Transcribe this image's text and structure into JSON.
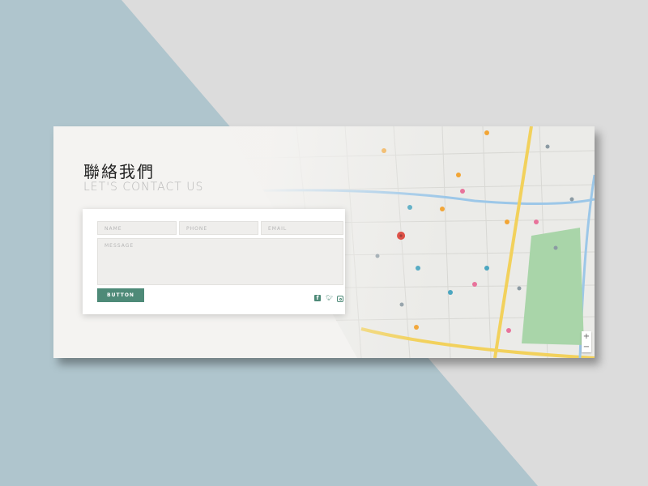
{
  "heading": {
    "title_cn": "聯絡我們",
    "title_en": "LET'S CONTACT US"
  },
  "form": {
    "name_placeholder": "NAME",
    "phone_placeholder": "PHONE",
    "email_placeholder": "EMAIL",
    "message_placeholder": "MESSAGE",
    "button_label": "BUTTON"
  },
  "social": {
    "facebook_icon": "facebook-icon",
    "twitter_icon": "twitter-icon",
    "instagram_icon": "instagram-icon"
  },
  "map": {
    "zoom_in": "+",
    "zoom_out": "−"
  },
  "colors": {
    "accent": "#4e8a78",
    "page_bg": "#afc5cd",
    "card_bg": "#f4f3f1"
  }
}
